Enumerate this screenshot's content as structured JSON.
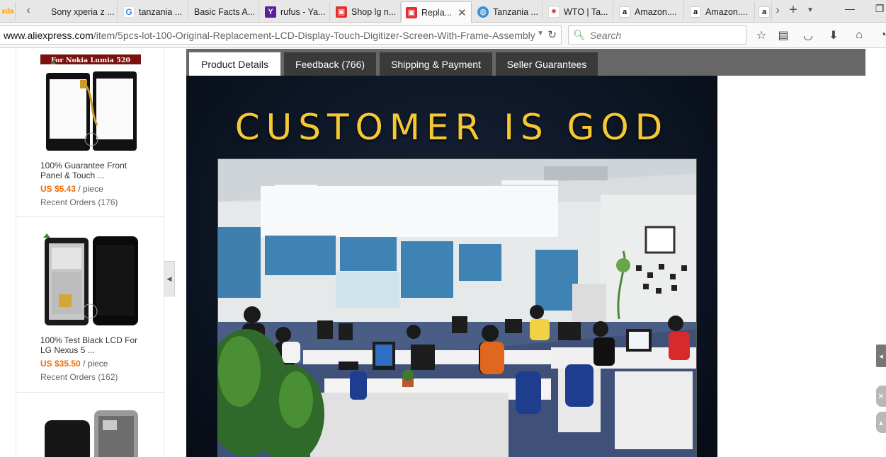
{
  "browser": {
    "tabs": [
      {
        "label": "",
        "favicon": "xda-icon"
      },
      {
        "label": "Sony xperia z ...",
        "favicon": ""
      },
      {
        "label": "tanzania ...",
        "favicon": "google-icon"
      },
      {
        "label": "Basic Facts A...",
        "favicon": ""
      },
      {
        "label": "rufus - Ya...",
        "favicon": "yahoo-icon"
      },
      {
        "label": "Shop lg n...",
        "favicon": "aliexpress-cart-icon"
      },
      {
        "label": "Repla...",
        "favicon": "aliexpress-cart-icon",
        "active": true
      },
      {
        "label": "Tanzania ...",
        "favicon": "globe-icon"
      },
      {
        "label": "WTO | Ta...",
        "favicon": "wto-icon"
      },
      {
        "label": "Amazon....",
        "favicon": "amazon-icon"
      },
      {
        "label": "Amazon....",
        "favicon": "amazon-icon"
      }
    ],
    "url_domain": "www.aliexpress.com",
    "url_path": "/item/5pcs-lot-100-Original-Replacement-LCD-Display-Touch-Digitizer-Screen-With-Frame-Assembly",
    "search_placeholder": "Search"
  },
  "sidebar": {
    "cards": [
      {
        "title": "100% Guarantee Front Panel & Touch ...",
        "price": "US $5.43",
        "unit": "/ piece",
        "orders": "Recent Orders (176)",
        "thumb_label": "For Nokia Lumia 520"
      },
      {
        "title": "100% Test Black LCD For LG Nexus 5 ...",
        "price": "US $35.50",
        "unit": "/ piece",
        "orders": "Recent Orders (162)"
      }
    ]
  },
  "product_tabs": [
    "Product Details",
    "Feedback (766)",
    "Shipping & Payment",
    "Seller Guarantees"
  ],
  "banner": {
    "headline": "CUSTOMER IS GOD"
  },
  "colors": {
    "price": "#f56a00",
    "headline": "#f5c933",
    "tabs_bg": "#676767"
  }
}
